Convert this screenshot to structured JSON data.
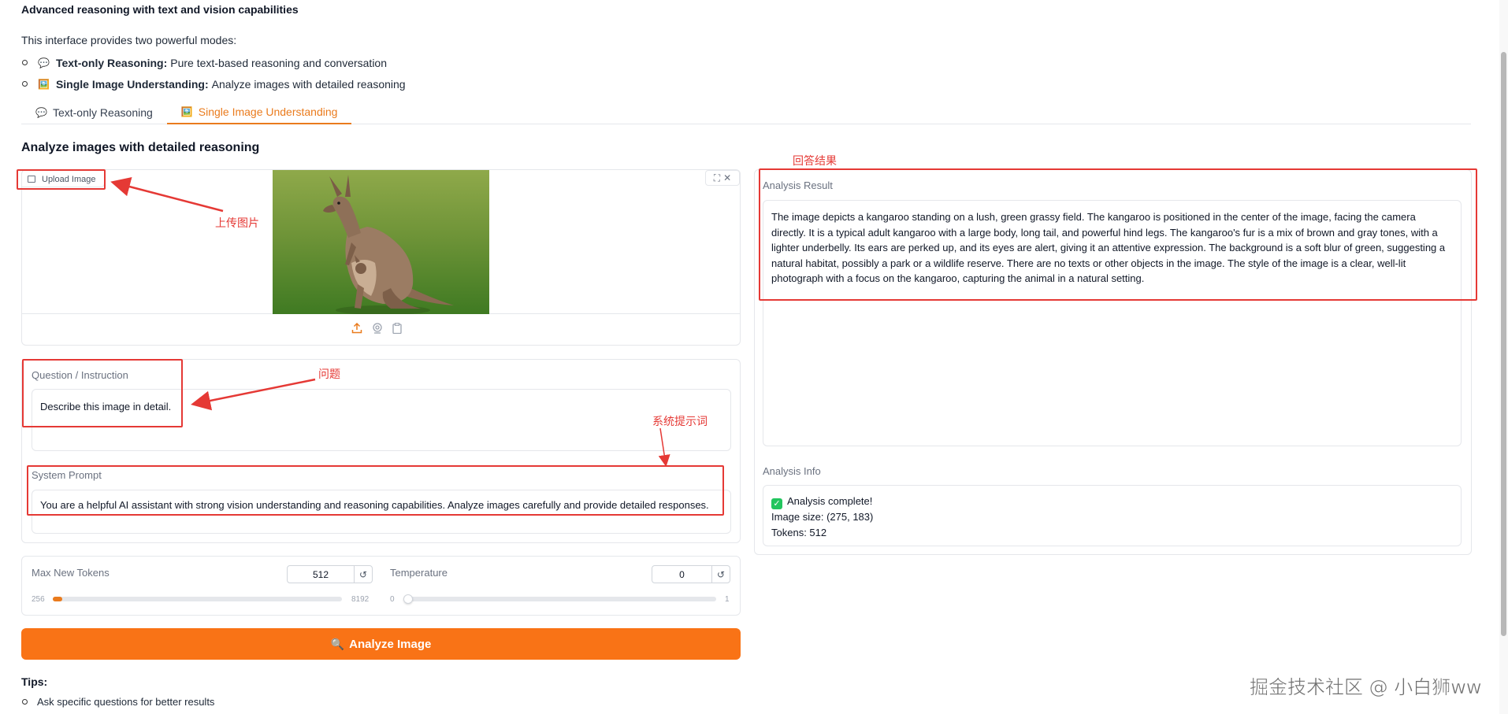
{
  "header": {
    "subtitle": "Advanced reasoning with text and vision capabilities",
    "intro": "This interface provides two powerful modes:",
    "modes": [
      {
        "emoji": "💬",
        "name": "Text-only Reasoning:",
        "desc": "Pure text-based reasoning and conversation"
      },
      {
        "emoji": "🖼️",
        "name": "Single Image Understanding:",
        "desc": "Analyze images with detailed reasoning"
      }
    ]
  },
  "tabs": [
    {
      "emoji": "💬",
      "label": "Text-only Reasoning"
    },
    {
      "emoji": "🖼️",
      "label": "Single Image Understanding"
    }
  ],
  "section_title": "Analyze images with detailed reasoning",
  "image_input": {
    "badge": "Upload Image",
    "fullscreen_icon": "⛶",
    "close_icon": "✕",
    "source_icons": [
      "upload-icon",
      "webcam-icon",
      "clipboard-icon"
    ]
  },
  "question": {
    "label": "Question / Instruction",
    "value": "Describe this image in detail."
  },
  "system_prompt": {
    "label": "System Prompt",
    "value": "You are a helpful AI assistant with strong vision understanding and reasoning capabilities. Analyze images carefully and provide detailed responses."
  },
  "sliders": {
    "max_tokens": {
      "label": "Max New Tokens",
      "value": "512",
      "min": "256",
      "max": "8192",
      "level": 0.0313
    },
    "temperature": {
      "label": "Temperature",
      "value": "0",
      "min": "0",
      "max": "1",
      "level": 0
    }
  },
  "analyze_button": {
    "icon": "🔍",
    "label": "Analyze Image"
  },
  "tips": {
    "title": "Tips:",
    "items": [
      "Ask specific questions for better results"
    ]
  },
  "result": {
    "label": "Analysis Result",
    "text": "The image depicts a kangaroo standing on a lush, green grassy field. The kangaroo is positioned in the center of the image, facing the camera directly. It is a typical adult kangaroo with a large body, long tail, and powerful hind legs. The kangaroo's fur is a mix of brown and gray tones, with a lighter underbelly. Its ears are perked up, and its eyes are alert, giving it an attentive expression. The background is a soft blur of green, suggesting a natural habitat, possibly a park or a wildlife reserve. There are no texts or other objects in the image. The style of the image is a clear, well-lit photograph with a focus on the kangaroo, capturing the animal in a natural setting."
  },
  "info": {
    "label": "Analysis Info",
    "status": "Analysis complete!",
    "image_size": "Image size: (275, 183)",
    "tokens": "Tokens: 512"
  },
  "annotations": {
    "upload": "上传图片",
    "question": "问题",
    "system_prompt": "系统提示词",
    "result": "回答结果"
  },
  "watermark": "掘金技术社区 @ 小白狮ww",
  "colors": {
    "accent": "#f97316",
    "annotation": "#e53935"
  }
}
